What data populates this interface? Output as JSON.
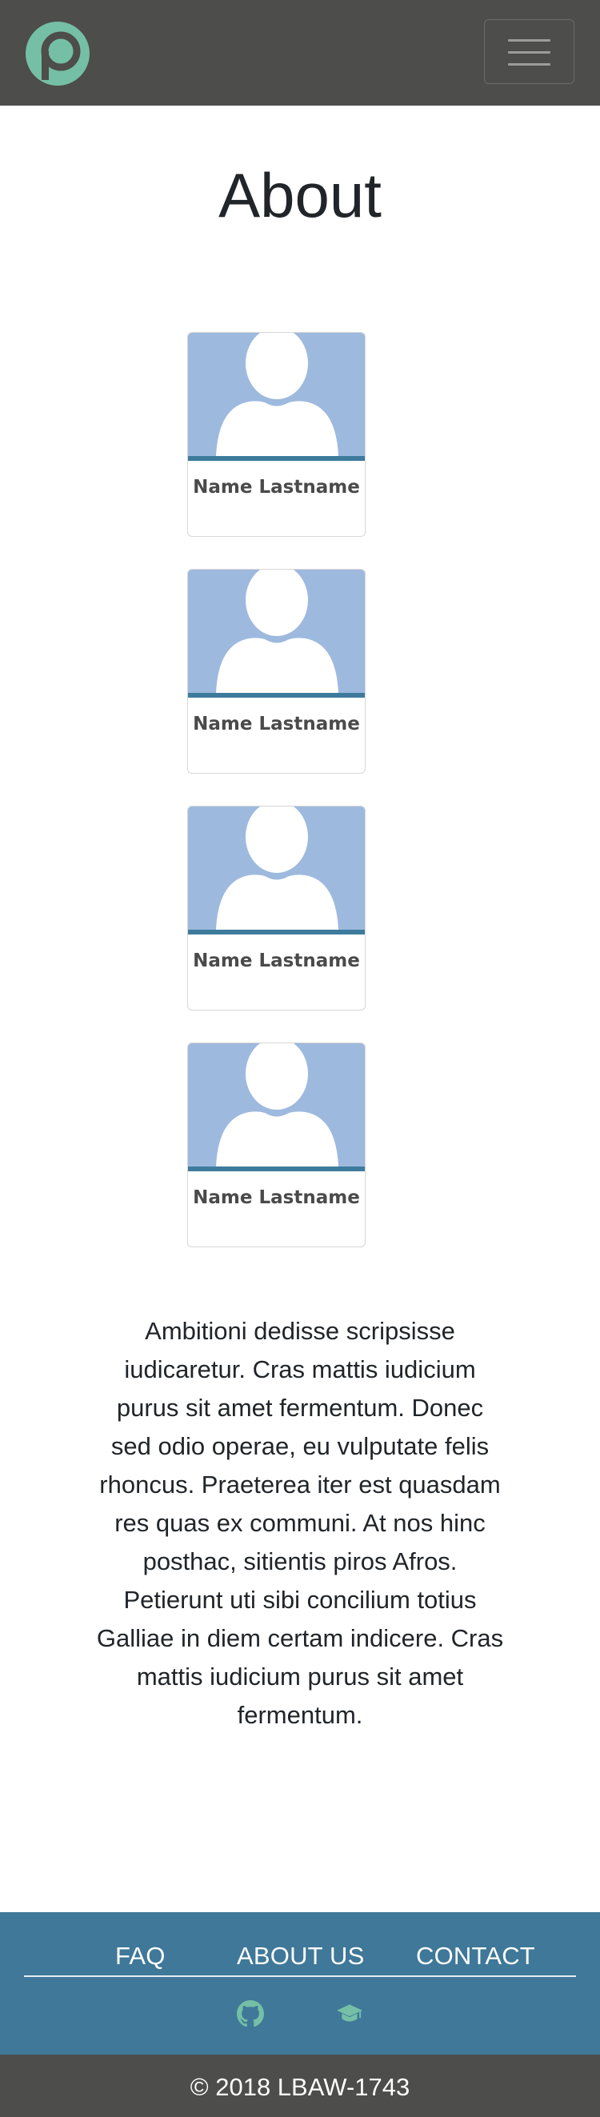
{
  "navbar": {
    "logo_icon": "p-logo-icon",
    "menu_toggle_icon": "hamburger-icon",
    "brand_color": "#75bfa6",
    "background": "#4d4d4b"
  },
  "page": {
    "title": "About"
  },
  "team": [
    {
      "name": "Name Lastname",
      "avatar_icon": "person-silhouette-icon"
    },
    {
      "name": "Name Lastname",
      "avatar_icon": "person-silhouette-icon"
    },
    {
      "name": "Name Lastname",
      "avatar_icon": "person-silhouette-icon"
    },
    {
      "name": "Name Lastname",
      "avatar_icon": "person-silhouette-icon"
    }
  ],
  "about_text": "Ambitioni dedisse scripsisse iudicaretur. Cras mattis iudicium purus sit amet fermentum. Donec sed odio operae, eu vulputate felis rhoncus. Praeterea iter est quasdam res quas ex communi. At nos hinc posthac, sitientis piros Afros. Petierunt uti sibi concilium totius Galliae in diem certam indicere. Cras mattis iudicium purus sit amet fermentum.",
  "footer": {
    "links": [
      "FAQ",
      "ABOUT US",
      "CONTACT"
    ],
    "icons": [
      "github-icon",
      "graduation-cap-icon"
    ],
    "background": "#3f7898",
    "icon_color": "#75bfa6"
  },
  "copyright": "© 2018 LBAW-1743"
}
